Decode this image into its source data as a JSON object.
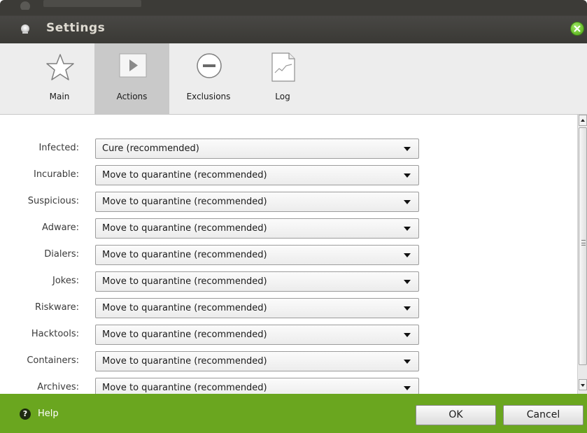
{
  "window": {
    "title": "Settings"
  },
  "toolbar": {
    "tabs": [
      {
        "label": "Main",
        "icon": "star-icon"
      },
      {
        "label": "Actions",
        "icon": "play-icon",
        "active": true
      },
      {
        "label": "Exclusions",
        "icon": "minus-circle-icon"
      },
      {
        "label": "Log",
        "icon": "log-document-icon"
      }
    ]
  },
  "actions": {
    "rows": [
      {
        "label": "Infected:",
        "value": "Cure (recommended)"
      },
      {
        "label": "Incurable:",
        "value": "Move to quarantine (recommended)"
      },
      {
        "label": "Suspicious:",
        "value": "Move to quarantine (recommended)"
      },
      {
        "label": "Adware:",
        "value": "Move to quarantine (recommended)"
      },
      {
        "label": "Dialers:",
        "value": "Move to quarantine (recommended)"
      },
      {
        "label": "Jokes:",
        "value": "Move to quarantine (recommended)"
      },
      {
        "label": "Riskware:",
        "value": "Move to quarantine (recommended)"
      },
      {
        "label": "Hacktools:",
        "value": "Move to quarantine (recommended)"
      },
      {
        "label": "Containers:",
        "value": "Move to quarantine (recommended)"
      },
      {
        "label": "Archives:",
        "value": "Move to quarantine (recommended)"
      }
    ]
  },
  "footer": {
    "help_icon_glyph": "?",
    "help_label": "Help",
    "ok_label": "OK",
    "cancel_label": "Cancel"
  },
  "colors": {
    "footer_green": "#6aa61f",
    "titlebar": "#3c3b37",
    "close_button": "#6dc12f",
    "active_tab": "#c9c9c9"
  }
}
